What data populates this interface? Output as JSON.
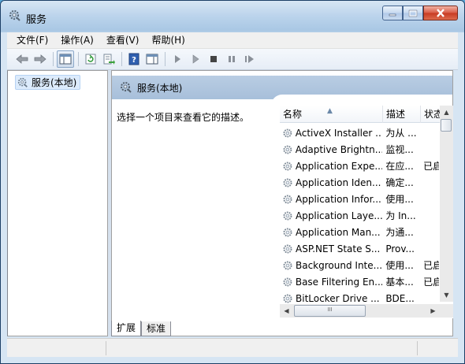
{
  "window": {
    "title": "服务"
  },
  "menu": [
    "文件(F)",
    "操作(A)",
    "查看(V)",
    "帮助(H)"
  ],
  "tree": {
    "root_label": "服务(本地)"
  },
  "right_pane": {
    "header_title": "服务(本地)",
    "description_prompt": "选择一个项目来查看它的描述。"
  },
  "list": {
    "columns": [
      "名称",
      "描述",
      "状态"
    ],
    "rows": [
      {
        "name": "ActiveX Installer ...",
        "desc": "为从 ...",
        "status": ""
      },
      {
        "name": "Adaptive Brightn...",
        "desc": "监视...",
        "status": ""
      },
      {
        "name": "Application Expe...",
        "desc": "在应...",
        "status": "已启"
      },
      {
        "name": "Application Iden...",
        "desc": "确定...",
        "status": ""
      },
      {
        "name": "Application Infor...",
        "desc": "使用...",
        "status": ""
      },
      {
        "name": "Application Laye...",
        "desc": "为 In...",
        "status": ""
      },
      {
        "name": "Application Man...",
        "desc": "为通...",
        "status": ""
      },
      {
        "name": "ASP.NET State S...",
        "desc": "Prov...",
        "status": ""
      },
      {
        "name": "Background Inte...",
        "desc": "使用...",
        "status": "已启"
      },
      {
        "name": "Base Filtering En...",
        "desc": "基本...",
        "status": "已启"
      },
      {
        "name": "BitLocker Drive ...",
        "desc": "BDE...",
        "status": ""
      }
    ]
  },
  "tabs": [
    "扩展",
    "标准"
  ],
  "hscroll_grip": "III"
}
